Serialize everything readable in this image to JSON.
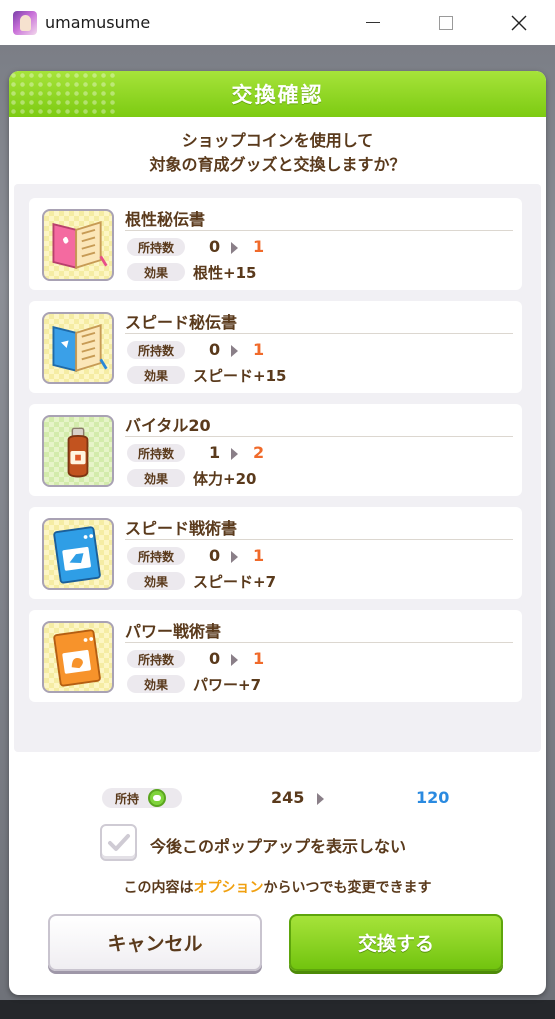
{
  "window": {
    "title": "umamusume",
    "icons": {
      "app": "umamusume-app-icon",
      "minimize": "minimize-icon",
      "maximize": "maximize-icon",
      "close": "close-icon"
    }
  },
  "dialog": {
    "title": "交換確認",
    "message_line1": "ショップコインを使用して",
    "message_line2": "対象の育成グッズと交換しますか？",
    "owned_label": "所持数",
    "effect_label": "効果",
    "items": [
      {
        "name": "根性秘伝書",
        "owned_from": "0",
        "owned_to": "1",
        "effect": "根性+15",
        "icon": "pink-manual-icon"
      },
      {
        "name": "スピード秘伝書",
        "owned_from": "0",
        "owned_to": "1",
        "effect": "スピード+15",
        "icon": "blue-manual-icon"
      },
      {
        "name": "バイタル20",
        "owned_from": "1",
        "owned_to": "2",
        "effect": "体力+20",
        "icon": "drink-bottle-icon"
      },
      {
        "name": "スピード戦術書",
        "owned_from": "0",
        "owned_to": "1",
        "effect": "スピード+7",
        "icon": "blue-tactics-book-icon"
      },
      {
        "name": "パワー戦術書",
        "owned_from": "0",
        "owned_to": "1",
        "effect": "パワー+7",
        "icon": "orange-tactics-book-icon"
      }
    ],
    "holdings": {
      "label": "所持",
      "coin_icon": "shop-coin-icon",
      "from": "245",
      "to": "120"
    },
    "dont_show": {
      "label": "今後このポップアップを表示しない",
      "checked": true
    },
    "note": {
      "prefix": "この内容は",
      "highlight": "オプション",
      "suffix": "からいつでも変更できます"
    },
    "buttons": {
      "cancel": "キャンセル",
      "confirm": "交換する"
    }
  },
  "colors": {
    "accent_green": "#7dcb12",
    "text_brown": "#5a3a1c",
    "increase_orange": "#f06a2a",
    "after_blue": "#2a8ae0",
    "option_orange": "#f0a010"
  }
}
